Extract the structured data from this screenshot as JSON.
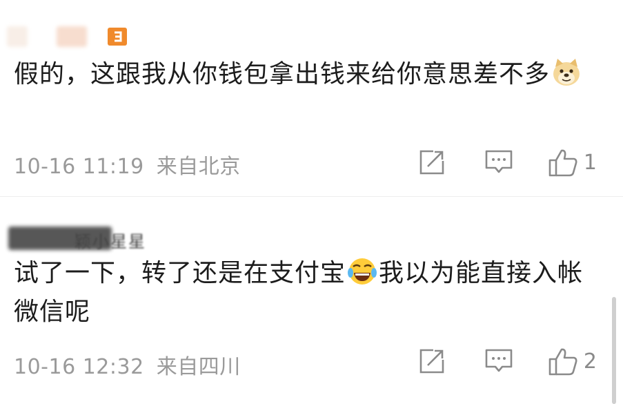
{
  "comments": [
    {
      "username": "",
      "text_before": "假的，这跟我从你钱包拿出钱来给你意思差不多",
      "emoji": "doge-emoji",
      "text_after": "",
      "date": "10-16 11:19",
      "location": "来自北京",
      "like_count": "1"
    },
    {
      "username": "颖小星星",
      "text_before": "试了一下，转了还是在支付宝",
      "emoji": "laughing-tears-emoji",
      "text_after": "我以为能直接入帐微信呢",
      "date": "10-16 12:32",
      "location": "来自四川",
      "like_count": "2"
    }
  ],
  "colors": {
    "text": "#1c1c1c",
    "meta": "#9a9a9a",
    "icon": "#8a8a8a",
    "badge": "#f08a2c"
  },
  "icons": [
    "share-icon",
    "comment-icon",
    "thumbs-up-icon"
  ]
}
